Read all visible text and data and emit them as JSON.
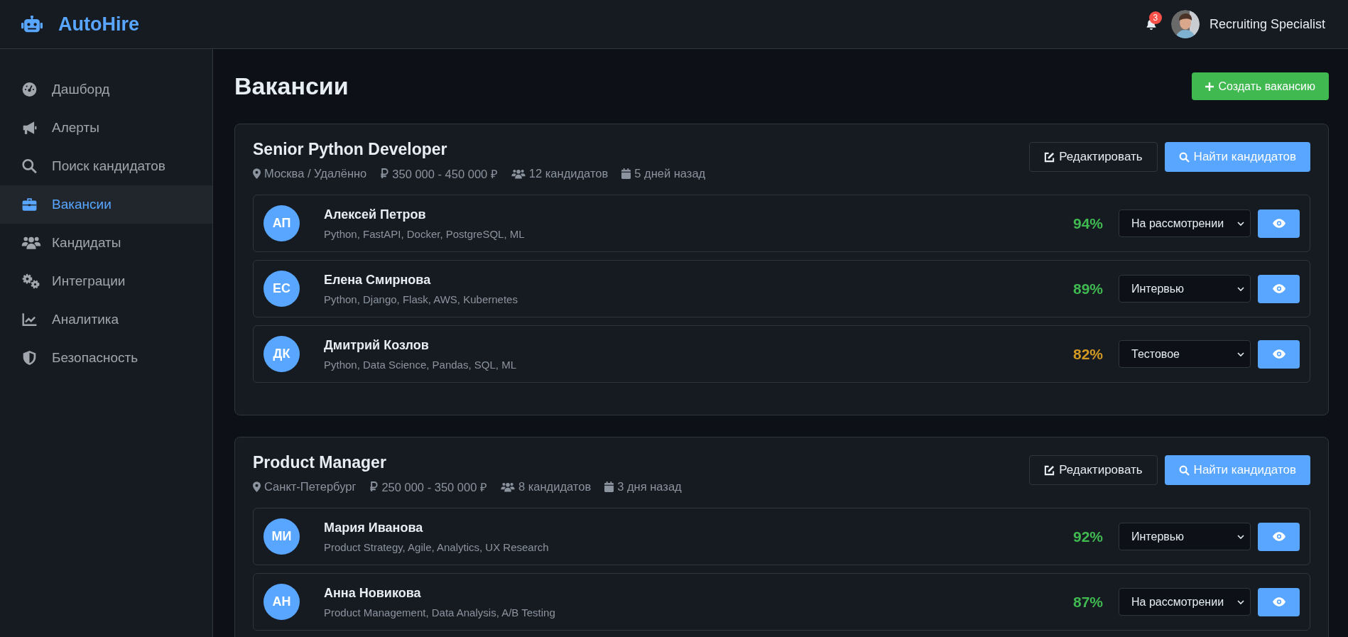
{
  "brand": {
    "name": "AutoHire"
  },
  "header": {
    "notifications": "3",
    "user": "Recruiting Specialist"
  },
  "sidebar": {
    "items": [
      {
        "label": "Дашборд",
        "kind": "gauge",
        "selected": false
      },
      {
        "label": "Алерты",
        "kind": "megaphone",
        "selected": false
      },
      {
        "label": "Поиск кандидатов",
        "kind": "search",
        "selected": false
      },
      {
        "label": "Вакансии",
        "kind": "briefcase",
        "selected": true
      },
      {
        "label": "Кандидаты",
        "kind": "users",
        "selected": false
      },
      {
        "label": "Интеграции",
        "kind": "gears",
        "selected": false
      },
      {
        "label": "Аналитика",
        "kind": "chart",
        "selected": false
      },
      {
        "label": "Безопасность",
        "kind": "shield",
        "selected": false
      }
    ]
  },
  "page": {
    "title": "Вакансии",
    "create_button": "Создать вакансию"
  },
  "jobs": [
    {
      "title": "Senior Python Developer",
      "location": "Москва / Удалённо",
      "salary": "350 000 - 450 000 ₽",
      "candidates_count": "12 кандидатов",
      "posted": "5 дней назад",
      "edit_button": "Редактировать",
      "find_button": "Найти кандидатов",
      "candidates": [
        {
          "initials": "АП",
          "name": "Алексей Петров",
          "skills": "Python, FastAPI, Docker, PostgreSQL, ML",
          "score": "94%",
          "color": "#3fb950",
          "status": "На рассмотрении"
        },
        {
          "initials": "ЕС",
          "name": "Елена Смирнова",
          "skills": "Python, Django, Flask, AWS, Kubernetes",
          "score": "89%",
          "color": "#3fb950",
          "status": "Интервью"
        },
        {
          "initials": "ДК",
          "name": "Дмитрий Козлов",
          "skills": "Python, Data Science, Pandas, SQL, ML",
          "score": "82%",
          "color": "#d29922",
          "status": "Тестовое"
        }
      ]
    },
    {
      "title": "Product Manager",
      "location": "Санкт-Петербург",
      "salary": "250 000 - 350 000 ₽",
      "candidates_count": "8 кандидатов",
      "posted": "3 дня назад",
      "edit_button": "Редактировать",
      "find_button": "Найти кандидатов",
      "candidates": [
        {
          "initials": "МИ",
          "name": "Мария Иванова",
          "skills": "Product Strategy, Agile, Analytics, UX Research",
          "score": "92%",
          "color": "#3fb950",
          "status": "Интервью"
        },
        {
          "initials": "АН",
          "name": "Анна Новикова",
          "skills": "Product Management, Data Analysis, A/B Testing",
          "score": "87%",
          "color": "#3fb950",
          "status": "На рассмотрении"
        }
      ]
    }
  ]
}
